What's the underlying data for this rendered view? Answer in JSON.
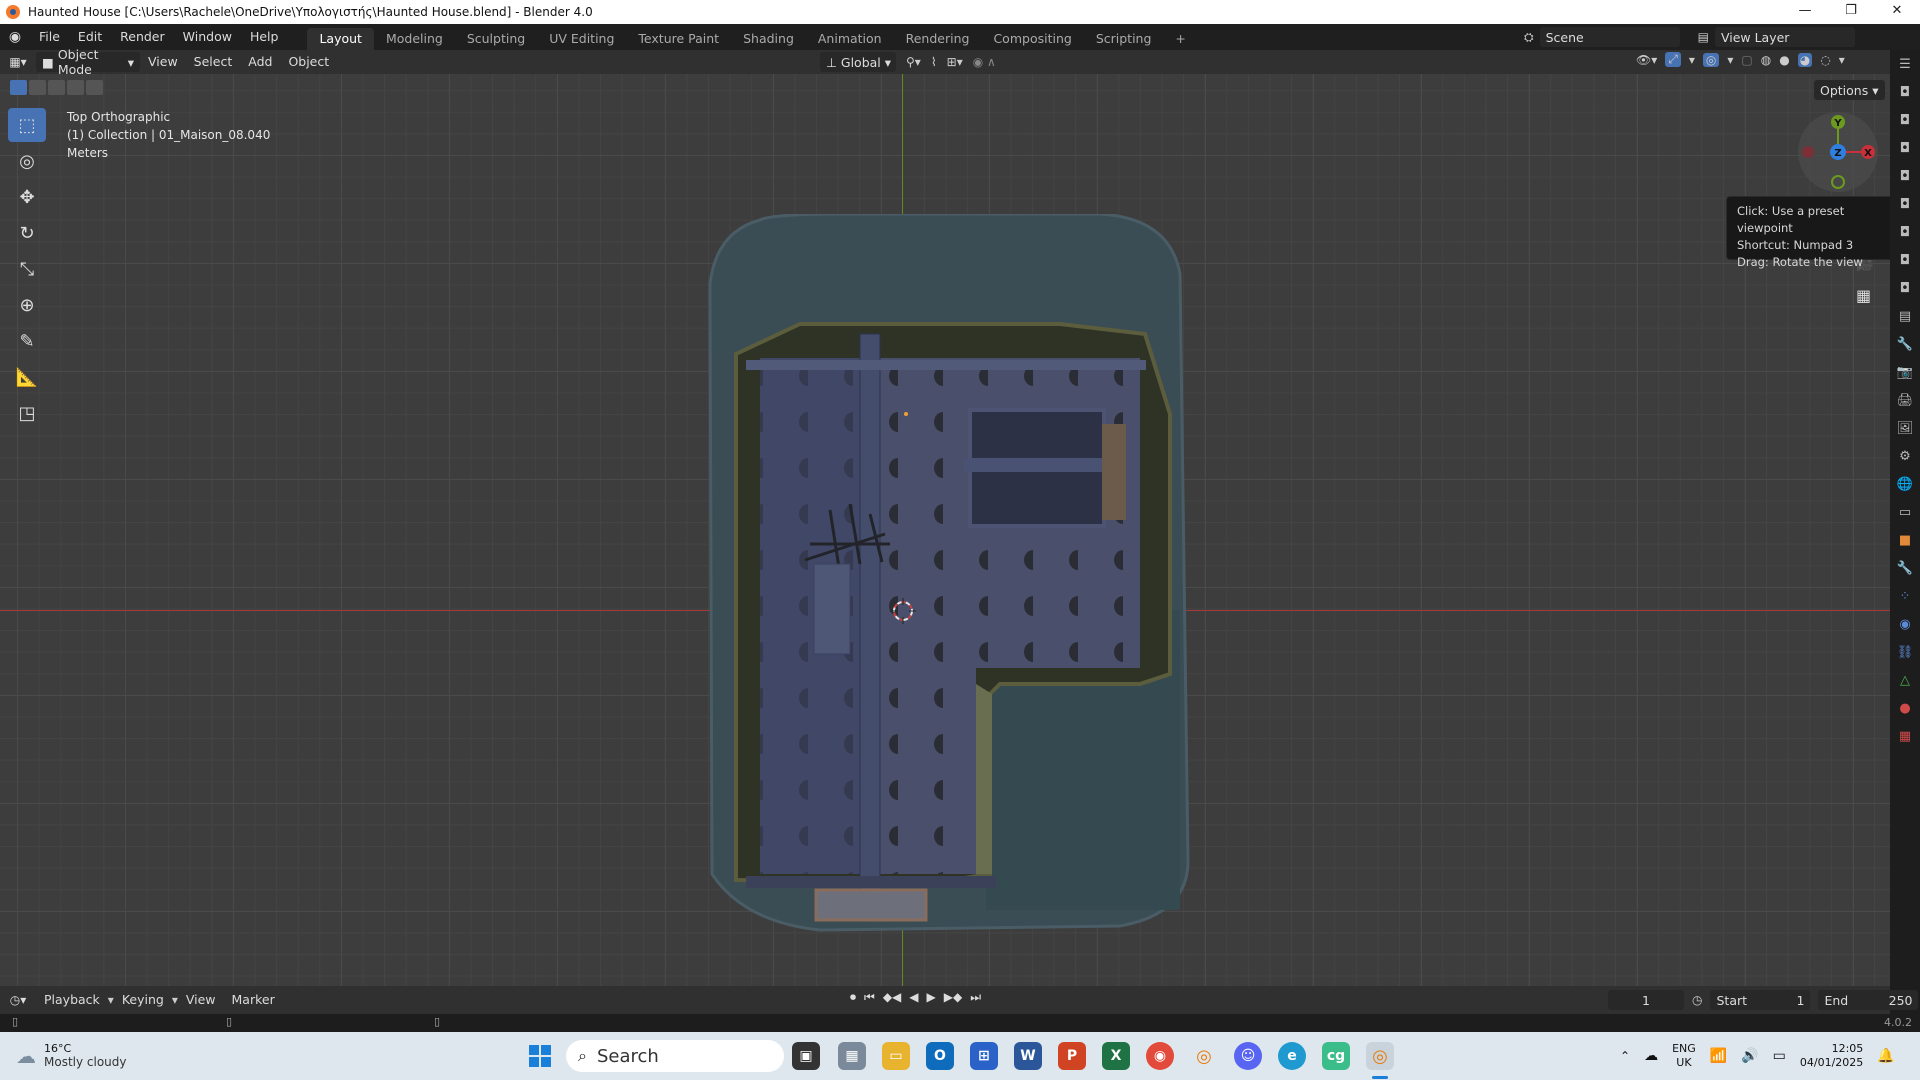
{
  "window": {
    "title": "Haunted House [C:\\Users\\Rachele\\OneDrive\\Υπολογιστής\\Haunted House.blend] - Blender 4.0",
    "controls": [
      "—",
      "❐",
      "✕"
    ]
  },
  "menu": {
    "items": [
      "File",
      "Edit",
      "Render",
      "Window",
      "Help"
    ]
  },
  "workspaces": {
    "tabs": [
      "Layout",
      "Modeling",
      "Sculpting",
      "UV Editing",
      "Texture Paint",
      "Shading",
      "Animation",
      "Rendering",
      "Compositing",
      "Scripting"
    ],
    "active": "Layout",
    "add_label": "+"
  },
  "scene": {
    "label": "Scene",
    "view_layer": "View Layer"
  },
  "header": {
    "mode": "Object Mode",
    "menus": [
      "View",
      "Select",
      "Add",
      "Object"
    ],
    "orientation": "Global",
    "options": "Options"
  },
  "viewport": {
    "view_name": "Top Orthographic",
    "collection": "(1) Collection | 01_Maison_08.040",
    "units": "Meters",
    "gizmo": {
      "y": "Y",
      "z": "Z",
      "x": "X"
    }
  },
  "tooltip": {
    "line1": "Click: Use a preset viewpoint",
    "line2": "Shortcut: Numpad 3",
    "line3": "Drag: Rotate the view"
  },
  "timeline": {
    "menus": [
      "Playback",
      "Keying",
      "View",
      "Marker"
    ],
    "current_frame": "1",
    "start_label": "Start",
    "start": "1",
    "end_label": "End",
    "end": "250"
  },
  "status": {
    "version": "4.0.2"
  },
  "taskbar": {
    "weather_temp": "16°C",
    "weather_desc": "Mostly cloudy",
    "search": "Search",
    "lang": "ENG",
    "region": "UK",
    "time": "12:05",
    "date": "04/01/2025"
  },
  "colors": {
    "accent": "#4772b3",
    "x_axis": "#c9303a",
    "y_axis": "#6b9a1f",
    "gizmo_z": "#2f7fe0"
  }
}
